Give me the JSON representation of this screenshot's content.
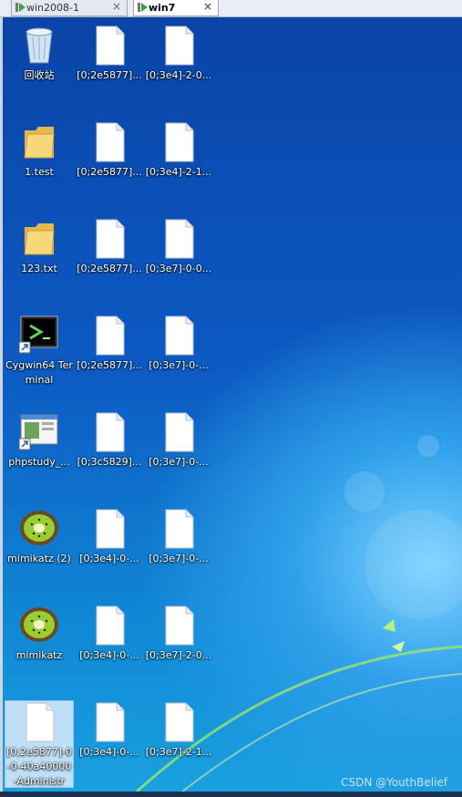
{
  "tabs": [
    {
      "label": "win2008-1",
      "close": "×"
    },
    {
      "label": "win7",
      "close": "×"
    }
  ],
  "desktop": {
    "col1": [
      {
        "label": "回收站",
        "icon": "recycle-bin-icon"
      },
      {
        "label": "1.test",
        "icon": "folder-icon"
      },
      {
        "label": "123.txt",
        "icon": "folder-icon"
      },
      {
        "label": "Cygwin64 Terminal",
        "icon": "cygwin-terminal-icon"
      },
      {
        "label": "phpstudy_...",
        "icon": "phpstudy-icon"
      },
      {
        "label": "mimikatz (2)",
        "icon": "kiwi-icon"
      },
      {
        "label": "mimikatz",
        "icon": "kiwi-icon"
      },
      {
        "label": "[0;2e5877]-0-0-40a40000-Administr",
        "icon": "file-icon"
      }
    ],
    "col2": [
      "[0;2e5877]...",
      "[0;2e5877]...",
      "[0;2e5877]...",
      "[0;2e5877]...",
      "[0;3c5829]...",
      "[0;3e4]-0-...",
      "[0;3e4]-0-...",
      "[0;3e4]-0-..."
    ],
    "col3": [
      "[0;3e4]-2-0...",
      "[0;3e4]-2-1...",
      "[0;3e7]-0-0...",
      "[0;3e7]-0-...",
      "[0;3e7]-0-...",
      "[0;3e7]-0-...",
      "[0;3e7]-2-0...",
      "[0;3e7]-2-1..."
    ]
  },
  "watermark": "CSDN @YouthBelief",
  "colors": {
    "desktop_top": "#0a44a8",
    "desktop_glow": "#7ed2ff",
    "tab_active": "#ffffff"
  }
}
